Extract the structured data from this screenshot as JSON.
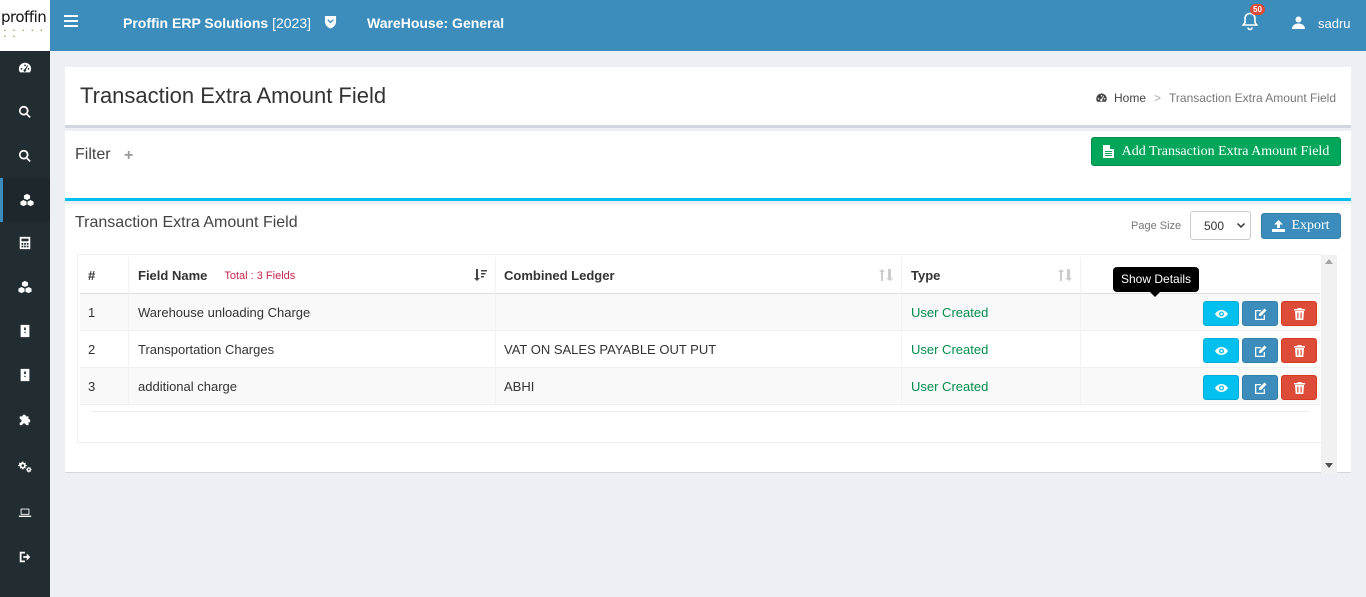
{
  "logo": {
    "text": "proffin",
    "dots": "• • • • • • •"
  },
  "sidebar": {
    "items": [
      {
        "icon": "dashboard-icon"
      },
      {
        "icon": "search-icon"
      },
      {
        "icon": "search-icon"
      },
      {
        "icon": "cubes-icon",
        "active": true
      },
      {
        "icon": "calculator-icon"
      },
      {
        "icon": "cubes-icon"
      },
      {
        "icon": "book-icon"
      },
      {
        "icon": "book-icon"
      },
      {
        "icon": "puzzle-icon"
      },
      {
        "icon": "gears-icon"
      },
      {
        "icon": "laptop-icon"
      },
      {
        "icon": "sign-out-icon"
      }
    ]
  },
  "header": {
    "app_name": "Proffin ERP Solutions",
    "app_year": "[2023]",
    "warehouse": "WareHouse: General",
    "notification_count": "50",
    "user_name": "sadru"
  },
  "page": {
    "title": "Transaction Extra Amount Field",
    "breadcrumb": {
      "home": "Home",
      "separator": ">",
      "current": "Transaction Extra Amount Field"
    }
  },
  "filter": {
    "label": "Filter",
    "toggle": "+",
    "add_button": "Add Transaction Extra Amount Field"
  },
  "table_box": {
    "title": "Transaction Extra Amount Field",
    "page_size_label": "Page Size",
    "page_size_value": "500",
    "export_label": "Export",
    "columns": {
      "num": "#",
      "field_name": "Field Name",
      "total": "Total : 3 Fields",
      "ledger": "Combined Ledger",
      "type": "Type"
    },
    "rows": [
      {
        "num": "1",
        "field_name": "Warehouse unloading Charge",
        "ledger": "",
        "type": "User Created"
      },
      {
        "num": "2",
        "field_name": "Transportation Charges",
        "ledger": "VAT ON SALES PAYABLE OUT PUT",
        "type": "User Created"
      },
      {
        "num": "3",
        "field_name": "additional charge",
        "ledger": "ABHI",
        "type": "User Created"
      }
    ],
    "tooltip": "Show Details"
  },
  "colors": {
    "primary": "#3c8dbc",
    "success": "#00a65a",
    "info": "#00c0ef",
    "danger": "#dd4b39",
    "sidebar": "#222d32"
  }
}
